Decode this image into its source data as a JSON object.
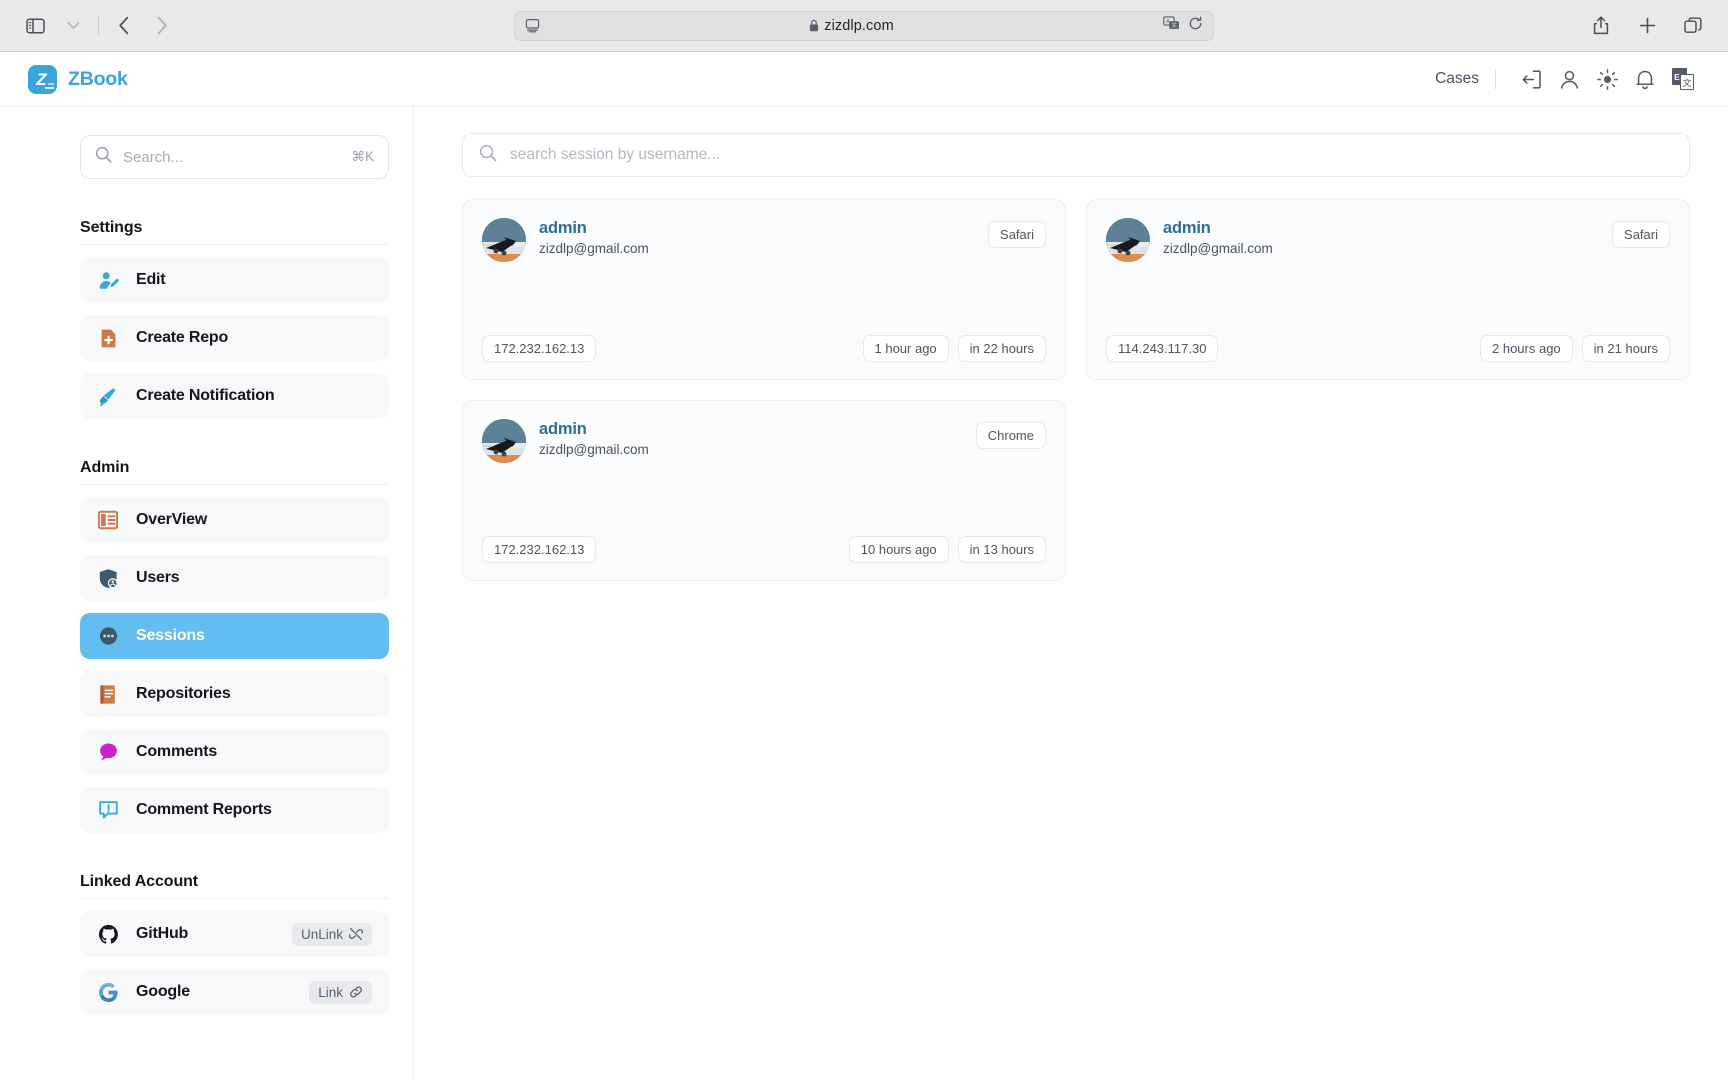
{
  "browser": {
    "url": "zizdlp.com",
    "lock_icon": "lock-icon",
    "sidebar_toggle_icon": "sidebar-toggle-icon",
    "sidebar_chevron_icon": "chevron-down-icon",
    "back_icon": "back-arrow-icon",
    "forward_icon": "forward-arrow-icon",
    "reader_icon": "reader-view-icon",
    "translate_icon": "translate-icon",
    "reload_icon": "reload-icon",
    "share_icon": "share-icon",
    "new_tab_icon": "plus-icon",
    "tabs_icon": "tab-overview-icon"
  },
  "header": {
    "brand_name": "ZBook",
    "brand_logo_letter": "Z",
    "cases_label": "Cases",
    "icons": [
      {
        "name": "logout-icon"
      },
      {
        "name": "user-icon"
      },
      {
        "name": "theme-sun-icon"
      },
      {
        "name": "notification-bell-icon"
      },
      {
        "name": "language-switch-icon"
      }
    ],
    "language": {
      "primary": "En",
      "secondary": "文"
    }
  },
  "sidebar": {
    "search": {
      "placeholder": "Search...",
      "shortcut": "⌘K",
      "icon": "search-icon"
    },
    "sections": [
      {
        "title": "Settings",
        "items": [
          {
            "label": "Edit",
            "icon": "user-edit-icon",
            "color": "#35a8e0",
            "active": false
          },
          {
            "label": "Create Repo",
            "icon": "file-plus-icon",
            "color": "#cb7a4b",
            "active": false
          },
          {
            "label": "Create Notification",
            "icon": "megaphone-icon",
            "color": "#35a8e0",
            "active": false
          }
        ]
      },
      {
        "title": "Admin",
        "items": [
          {
            "label": "OverView",
            "icon": "layout-panel-icon",
            "color": "#cb7a4b",
            "active": false
          },
          {
            "label": "Users",
            "icon": "shield-user-icon",
            "color": "#3d5a6c",
            "active": false
          },
          {
            "label": "Sessions",
            "icon": "sessions-dots-icon",
            "color": "#3d5a6c",
            "active": true
          },
          {
            "label": "Repositories",
            "icon": "book-icon",
            "color": "#cb7a4b",
            "active": false
          },
          {
            "label": "Comments",
            "icon": "comment-bubble-icon",
            "color": "#cc22cc",
            "active": false
          },
          {
            "label": "Comment Reports",
            "icon": "comment-alert-icon",
            "color": "#35a8e0",
            "active": false
          }
        ]
      },
      {
        "title": "Linked Account",
        "items": [
          {
            "label": "GitHub",
            "icon": "github-icon",
            "color": "#16181d",
            "active": false,
            "action_label": "UnLink",
            "action_icon": "unlink-icon"
          },
          {
            "label": "Google",
            "icon": "google-icon",
            "color": "#4a90c7",
            "active": false,
            "action_label": "Link",
            "action_icon": "link-icon"
          }
        ]
      }
    ]
  },
  "main": {
    "search": {
      "placeholder": "search session by username...",
      "icon": "search-icon"
    },
    "sessions": [
      {
        "username": "admin",
        "email": "zizdlp@gmail.com",
        "browser": "Safari",
        "ip": "172.232.162.13",
        "last_active": "1 hour ago",
        "expires": "in 22 hours"
      },
      {
        "username": "admin",
        "email": "zizdlp@gmail.com",
        "browser": "Safari",
        "ip": "114.243.117.30",
        "last_active": "2 hours ago",
        "expires": "in 21 hours"
      },
      {
        "username": "admin",
        "email": "zizdlp@gmail.com",
        "browser": "Chrome",
        "ip": "172.232.162.13",
        "last_active": "10 hours ago",
        "expires": "in 13 hours"
      }
    ]
  },
  "colors": {
    "accent": "#3aa4dd",
    "active_nav": "#63bdf0",
    "card_bg": "#fafbfc",
    "name_link": "#2f6e91"
  }
}
